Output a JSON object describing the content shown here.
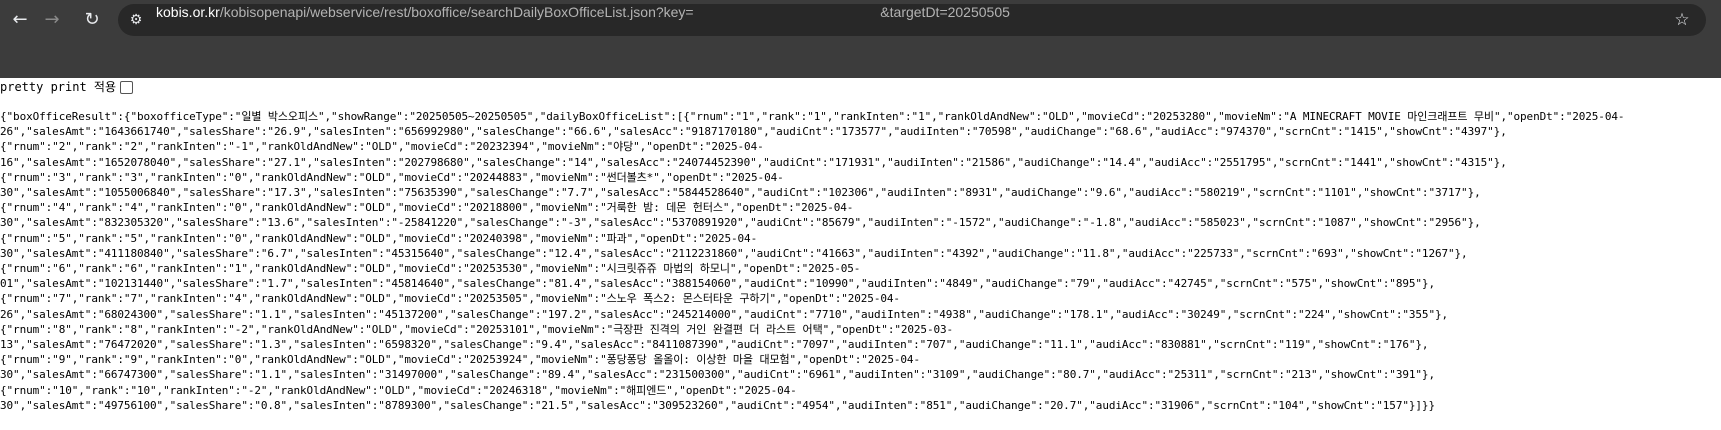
{
  "browser": {
    "url_host": "kobis.or.kr",
    "url_rest": "/kobisopenapi/webservice/rest/boxoffice/searchDailyBoxOfficeList.json?key=                                                &targetDt=20250505",
    "icons": {
      "back": "back-arrow-icon",
      "forward": "forward-arrow-icon",
      "reload": "reload-icon",
      "site_info": "site-info-icon",
      "bookmark": "star-icon"
    }
  },
  "pretty_print": {
    "label": "pretty print 적용"
  },
  "json_lines": [
    "{\"boxOfficeResult\":{\"boxofficeType\":\"일별 박스오피스\",\"showRange\":\"20250505~20250505\",\"dailyBoxOfficeList\":[{\"rnum\":\"1\",\"rank\":\"1\",\"rankInten\":\"1\",\"rankOldAndNew\":\"OLD\",\"movieCd\":\"20253280\",\"movieNm\":\"A MINECRAFT MOVIE 마인크래프트 무비\",\"openDt\":\"2025-04-",
    "26\",\"salesAmt\":\"1643661740\",\"salesShare\":\"26.9\",\"salesInten\":\"656992980\",\"salesChange\":\"66.6\",\"salesAcc\":\"9187170180\",\"audiCnt\":\"173577\",\"audiInten\":\"70598\",\"audiChange\":\"68.6\",\"audiAcc\":\"974370\",\"scrnCnt\":\"1415\",\"showCnt\":\"4397\"},",
    "{\"rnum\":\"2\",\"rank\":\"2\",\"rankInten\":\"-1\",\"rankOldAndNew\":\"OLD\",\"movieCd\":\"20232394\",\"movieNm\":\"야당\",\"openDt\":\"2025-04-",
    "16\",\"salesAmt\":\"1652078040\",\"salesShare\":\"27.1\",\"salesInten\":\"202798680\",\"salesChange\":\"14\",\"salesAcc\":\"24074452390\",\"audiCnt\":\"171931\",\"audiInten\":\"21586\",\"audiChange\":\"14.4\",\"audiAcc\":\"2551795\",\"scrnCnt\":\"1441\",\"showCnt\":\"4315\"},",
    "{\"rnum\":\"3\",\"rank\":\"3\",\"rankInten\":\"0\",\"rankOldAndNew\":\"OLD\",\"movieCd\":\"20244883\",\"movieNm\":\"썬더볼츠*\",\"openDt\":\"2025-04-",
    "30\",\"salesAmt\":\"1055006840\",\"salesShare\":\"17.3\",\"salesInten\":\"75635390\",\"salesChange\":\"7.7\",\"salesAcc\":\"5844528640\",\"audiCnt\":\"102306\",\"audiInten\":\"8931\",\"audiChange\":\"9.6\",\"audiAcc\":\"580219\",\"scrnCnt\":\"1101\",\"showCnt\":\"3717\"},",
    "{\"rnum\":\"4\",\"rank\":\"4\",\"rankInten\":\"0\",\"rankOldAndNew\":\"OLD\",\"movieCd\":\"20218800\",\"movieNm\":\"거룩한 밤: 데몬 헌터스\",\"openDt\":\"2025-04-",
    "30\",\"salesAmt\":\"832305320\",\"salesShare\":\"13.6\",\"salesInten\":\"-25841220\",\"salesChange\":\"-3\",\"salesAcc\":\"5370891920\",\"audiCnt\":\"85679\",\"audiInten\":\"-1572\",\"audiChange\":\"-1.8\",\"audiAcc\":\"585023\",\"scrnCnt\":\"1087\",\"showCnt\":\"2956\"},",
    "{\"rnum\":\"5\",\"rank\":\"5\",\"rankInten\":\"0\",\"rankOldAndNew\":\"OLD\",\"movieCd\":\"20240398\",\"movieNm\":\"파과\",\"openDt\":\"2025-04-",
    "30\",\"salesAmt\":\"411180840\",\"salesShare\":\"6.7\",\"salesInten\":\"45315640\",\"salesChange\":\"12.4\",\"salesAcc\":\"2112231860\",\"audiCnt\":\"41663\",\"audiInten\":\"4392\",\"audiChange\":\"11.8\",\"audiAcc\":\"225733\",\"scrnCnt\":\"693\",\"showCnt\":\"1267\"},",
    "{\"rnum\":\"6\",\"rank\":\"6\",\"rankInten\":\"1\",\"rankOldAndNew\":\"OLD\",\"movieCd\":\"20253530\",\"movieNm\":\"시크릿쥬쥬 마법의 하모니\",\"openDt\":\"2025-05-",
    "01\",\"salesAmt\":\"102131440\",\"salesShare\":\"1.7\",\"salesInten\":\"45814640\",\"salesChange\":\"81.4\",\"salesAcc\":\"388154060\",\"audiCnt\":\"10990\",\"audiInten\":\"4849\",\"audiChange\":\"79\",\"audiAcc\":\"42745\",\"scrnCnt\":\"575\",\"showCnt\":\"895\"},",
    "{\"rnum\":\"7\",\"rank\":\"7\",\"rankInten\":\"4\",\"rankOldAndNew\":\"OLD\",\"movieCd\":\"20253505\",\"movieNm\":\"스노우 폭스2: 몬스터타운 구하기\",\"openDt\":\"2025-04-",
    "26\",\"salesAmt\":\"68024300\",\"salesShare\":\"1.1\",\"salesInten\":\"45137200\",\"salesChange\":\"197.2\",\"salesAcc\":\"245214000\",\"audiCnt\":\"7710\",\"audiInten\":\"4938\",\"audiChange\":\"178.1\",\"audiAcc\":\"30249\",\"scrnCnt\":\"224\",\"showCnt\":\"355\"},",
    "{\"rnum\":\"8\",\"rank\":\"8\",\"rankInten\":\"-2\",\"rankOldAndNew\":\"OLD\",\"movieCd\":\"20253101\",\"movieNm\":\"극장판 진격의 거인 완결편 더 라스트 어택\",\"openDt\":\"2025-03-",
    "13\",\"salesAmt\":\"76472020\",\"salesShare\":\"1.3\",\"salesInten\":\"6598320\",\"salesChange\":\"9.4\",\"salesAcc\":\"8411087390\",\"audiCnt\":\"7097\",\"audiInten\":\"707\",\"audiChange\":\"11.1\",\"audiAcc\":\"830881\",\"scrnCnt\":\"119\",\"showCnt\":\"176\"},",
    "{\"rnum\":\"9\",\"rank\":\"9\",\"rankInten\":\"0\",\"rankOldAndNew\":\"OLD\",\"movieCd\":\"20253924\",\"movieNm\":\"퐁당퐁당 올올이: 이상한 마을 대모험\",\"openDt\":\"2025-04-",
    "30\",\"salesAmt\":\"66747300\",\"salesShare\":\"1.1\",\"salesInten\":\"31497000\",\"salesChange\":\"89.4\",\"salesAcc\":\"231500300\",\"audiCnt\":\"6961\",\"audiInten\":\"3109\",\"audiChange\":\"80.7\",\"audiAcc\":\"25311\",\"scrnCnt\":\"213\",\"showCnt\":\"391\"},",
    "{\"rnum\":\"10\",\"rank\":\"10\",\"rankInten\":\"-2\",\"rankOldAndNew\":\"OLD\",\"movieCd\":\"20246318\",\"movieNm\":\"해피엔드\",\"openDt\":\"2025-04-",
    "30\",\"salesAmt\":\"49756100\",\"salesShare\":\"0.8\",\"salesInten\":\"8789300\",\"salesChange\":\"21.5\",\"salesAcc\":\"309523260\",\"audiCnt\":\"4954\",\"audiInten\":\"851\",\"audiChange\":\"20.7\",\"audiAcc\":\"31906\",\"scrnCnt\":\"104\",\"showCnt\":\"157\"}]}}"
  ]
}
